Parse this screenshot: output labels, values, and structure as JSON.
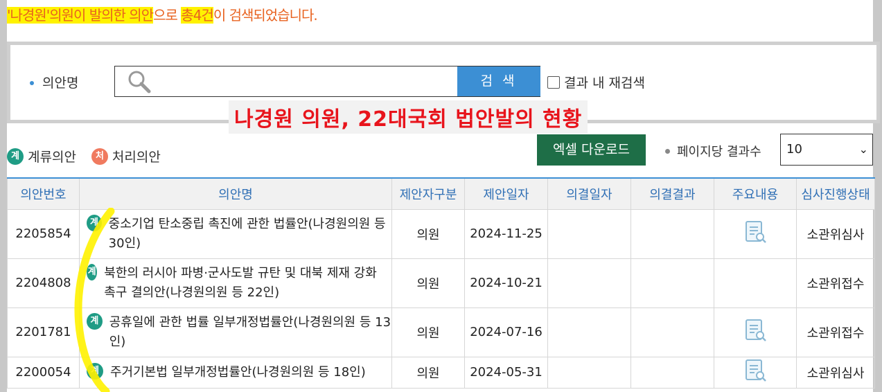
{
  "result_message": {
    "part1": "'나경원'의원이 발의한 의안",
    "part2": "으로 ",
    "part3": "총4건",
    "part4": "이 검색되었습니다."
  },
  "search": {
    "field_label": "의안명",
    "input_value": "",
    "button_label": "검 색",
    "research_label": "결과 내 재검색"
  },
  "overlay_title": "나경원 의원, 22대국회 법안발의 현황",
  "legend": {
    "pending_badge": "계",
    "pending_label": "계류의안",
    "done_badge": "처",
    "done_label": "처리의안"
  },
  "excel_button": "엑셀 다운로드",
  "perpage": {
    "label": "페이지당 결과수",
    "selected": "10"
  },
  "table": {
    "headers": [
      "의안번호",
      "의안명",
      "제안자구분",
      "제안일자",
      "의결일자",
      "의결결과",
      "주요내용",
      "심사진행상태"
    ],
    "rows": [
      {
        "no": "2205854",
        "badge": "계",
        "title": "중소기업 탄소중립 촉진에 관한 법률안(나경원의원 등 30인)",
        "proposer": "의원",
        "date": "2024-11-25",
        "decision_date": "",
        "result": "",
        "has_summary": true,
        "status": "소관위심사"
      },
      {
        "no": "2204808",
        "badge": "계",
        "title": "북한의 러시아 파병·군사도발 규탄 및 대북 제재 강화 촉구 결의안(나경원의원 등 22인)",
        "proposer": "의원",
        "date": "2024-10-21",
        "decision_date": "",
        "result": "",
        "has_summary": false,
        "status": "소관위접수"
      },
      {
        "no": "2201781",
        "badge": "계",
        "title": "공휴일에 관한 법률 일부개정법률안(나경원의원 등 13인)",
        "proposer": "의원",
        "date": "2024-07-16",
        "decision_date": "",
        "result": "",
        "has_summary": true,
        "status": "소관위접수"
      },
      {
        "no": "2200054",
        "badge": "계",
        "title": "주거기본법 일부개정법률안(나경원의원 등 18인)",
        "proposer": "의원",
        "date": "2024-05-31",
        "decision_date": "",
        "result": "",
        "has_summary": true,
        "status": "소관위심사"
      }
    ]
  },
  "icons": {
    "search": "magnifier-icon",
    "summary": "document-search-icon"
  },
  "colors": {
    "accent_blue": "#3c8fd4",
    "highlight_yellow": "#fff200",
    "message_orange": "#e8621f",
    "overlay_red": "#e8141c",
    "excel_green": "#1e6e47",
    "pending_badge": "#1f9c85",
    "done_badge": "#f07a5f"
  }
}
